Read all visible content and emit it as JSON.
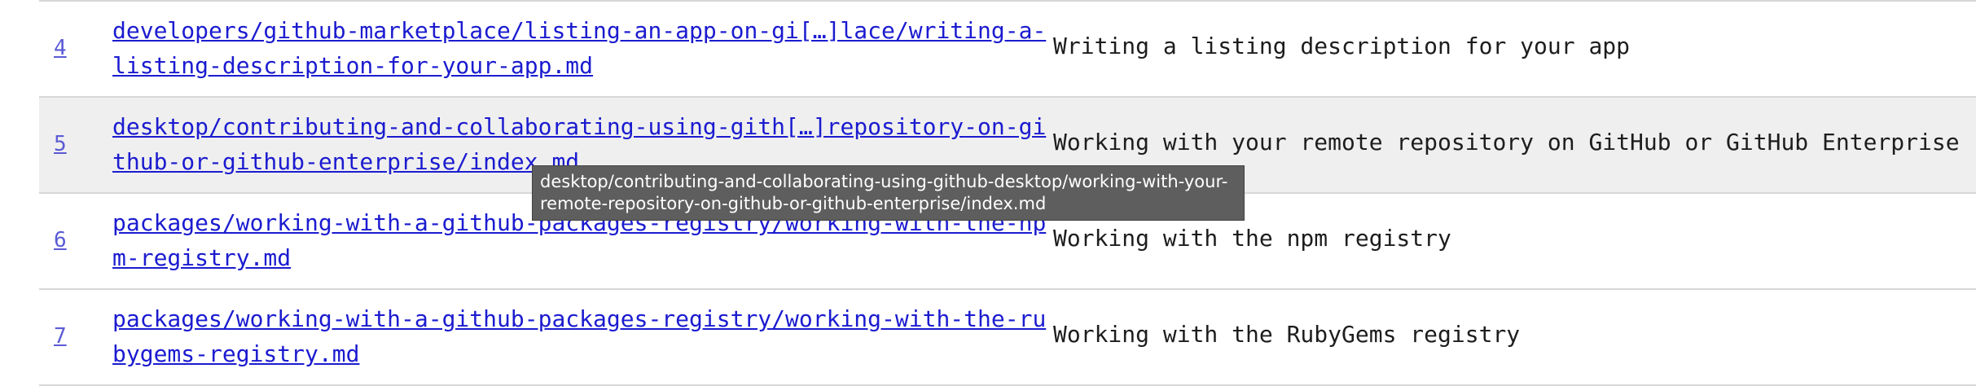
{
  "rows": [
    {
      "number": "4",
      "path": "developers/github-marketplace/listing-an-app-on-gi[…]lace/writing-a-listing-description-for-your-app.md",
      "title": "Writing a listing description for your app"
    },
    {
      "number": "5",
      "path": "desktop/contributing-and-collaborating-using-gith[…]repository-on-github-or-github-enterprise/index.md",
      "title": "Working with your remote repository on GitHub or GitHub Enterprise"
    },
    {
      "number": "6",
      "path": "packages/working-with-a-github-packages-registry/working-with-the-npm-registry.md",
      "title": "Working with the npm registry"
    },
    {
      "number": "7",
      "path": "packages/working-with-a-github-packages-registry/working-with-the-rubygems-registry.md",
      "title": "Working with the RubyGems registry"
    }
  ],
  "tooltip": {
    "text": "desktop/contributing-and-collaborating-using-github-desktop/working-with-your-remote-repository-on-github-or-github-enterprise/index.md"
  }
}
